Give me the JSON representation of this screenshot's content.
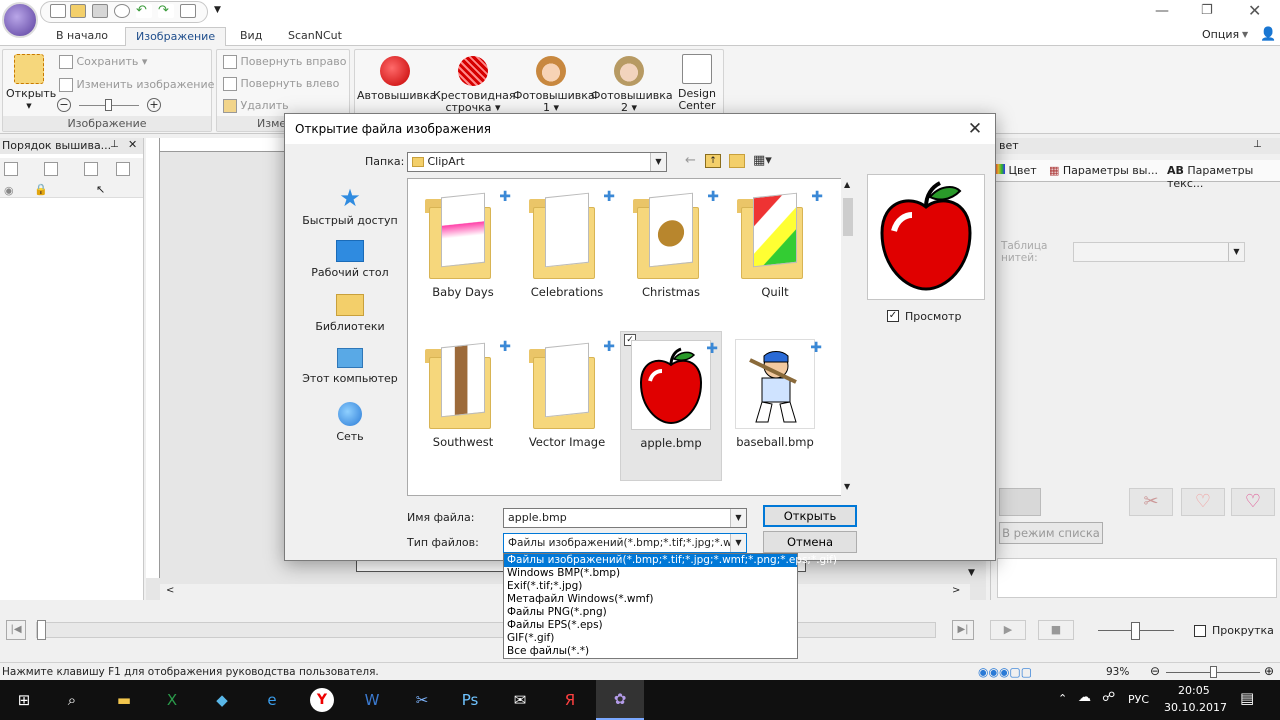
{
  "app": {
    "tabs": [
      "В начало",
      "Изображение",
      "Вид",
      "ScanNCut"
    ],
    "active_tab": "Изображение",
    "option_label": "Опция"
  },
  "ribbon": {
    "image_group": {
      "open_label": "Открыть",
      "save_label": "Сохранить",
      "change_label": "Изменить изображение",
      "label": "Изображение"
    },
    "rotate_group": {
      "rotate_right": "Повернуть вправо",
      "rotate_left": "Повернуть влево",
      "delete": "Удалить",
      "label": "Изме"
    },
    "embroidery_group": {
      "auto": "Автовышивка",
      "cross": "Крестовидная строчка",
      "photo1": "Фотовышивка 1",
      "photo2": "Фотовышивка 2",
      "design": "Design Center"
    }
  },
  "left_panel": {
    "title": "Порядок вышива..."
  },
  "right_panel": {
    "title": "вет",
    "tabs": [
      "Цвет",
      "Параметры вы...",
      "Параметры текс..."
    ],
    "thread_table_label": "Таблица нитей:",
    "list_mode_button": "В режим списка"
  },
  "dialog": {
    "title": "Открытие файла изображения",
    "folder_label": "Папка:",
    "folder_value": "ClipArt",
    "places": [
      "Быстрый доступ",
      "Рабочий стол",
      "Библиотеки",
      "Этот компьютер",
      "Сеть"
    ],
    "files": [
      {
        "name": "Baby Days",
        "kind": "folder"
      },
      {
        "name": "Celebrations",
        "kind": "folder"
      },
      {
        "name": "Christmas",
        "kind": "folder"
      },
      {
        "name": "Quilt",
        "kind": "folder"
      },
      {
        "name": "Southwest",
        "kind": "folder"
      },
      {
        "name": "Vector Image",
        "kind": "folder"
      },
      {
        "name": "apple.bmp",
        "kind": "image",
        "selected": true
      },
      {
        "name": "baseball.bmp",
        "kind": "image"
      }
    ],
    "preview_label": "Просмотр",
    "preview_checked": true,
    "filename_label": "Имя файла:",
    "filename_value": "apple.bmp",
    "filetype_label": "Тип файлов:",
    "filetype_value": "Файлы изображений(*.bmp;*.tif;*.jpg;*.wmf;*.p",
    "open_button": "Открыть",
    "cancel_button": "Отмена",
    "filetype_options": [
      "Файлы изображений(*.bmp;*.tif;*.jpg;*.wmf;*.png;*.eps;*.gif)",
      "Windows BMP(*.bmp)",
      "Exif(*.tif;*.jpg)",
      "Метафайл Windows(*.wmf)",
      "Файлы PNG(*.png)",
      "Файлы EPS(*.eps)",
      "GIF(*.gif)",
      "Все файлы(*.*)"
    ]
  },
  "playback": {
    "shortcut_label": "Прокрутка"
  },
  "status": {
    "hint": "Нажмите клавишу F1 для отображения руководства пользователя.",
    "zoom": "93%"
  },
  "taskbar": {
    "lang": "РУС",
    "time": "20:05",
    "date": "30.10.2017"
  },
  "colors": {
    "accent": "#0078d7",
    "taskbar": "#101010",
    "apple_red": "#e00000"
  }
}
